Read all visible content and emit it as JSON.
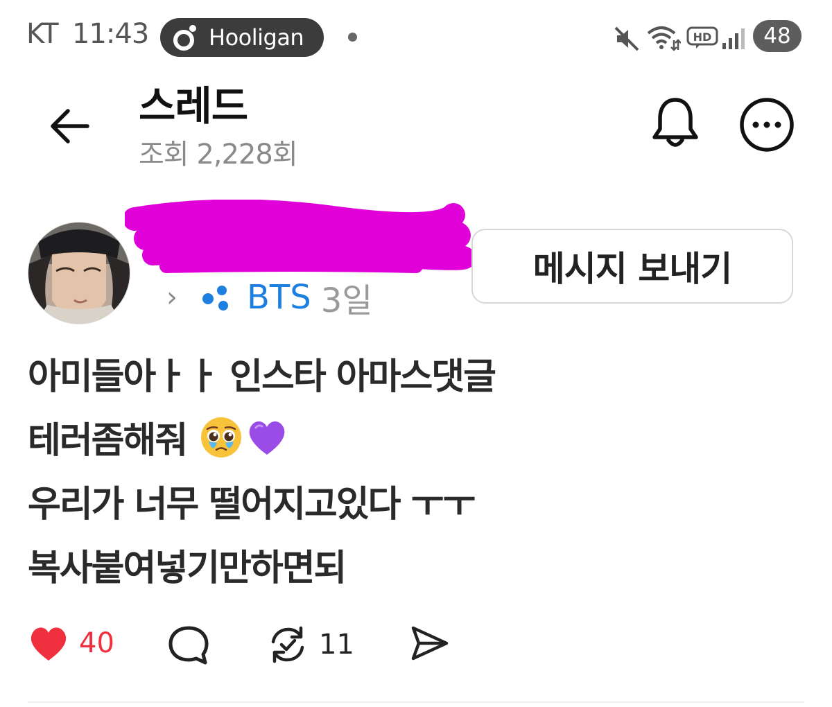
{
  "status_bar": {
    "carrier": "KT",
    "time": "11:43",
    "app_pill": "Hooligan",
    "battery": "48",
    "icons": [
      "mute-icon",
      "wifi-icon",
      "hd-icon",
      "signal-icon"
    ]
  },
  "header": {
    "title": "스레드",
    "views": "조회 2,228회"
  },
  "post": {
    "community": "BTS",
    "age": "3일",
    "message_button": "메시지 보내기",
    "lines": [
      "아미들아ㅏㅏ 인스타 아마스댓글",
      "테러좀해줘",
      "우리가 너무 떨어지고있다 ㅜㅜ",
      "복사붙여넣기만하면되"
    ],
    "emojis": [
      "pleading-face-emoji",
      "purple-heart-emoji"
    ]
  },
  "actions": {
    "likes": "40",
    "reposts": "11"
  },
  "colors": {
    "like": "#f0303e",
    "community": "#1d7fe0",
    "redaction": "#e000d8",
    "pill_bg": "#3c3c3c"
  }
}
